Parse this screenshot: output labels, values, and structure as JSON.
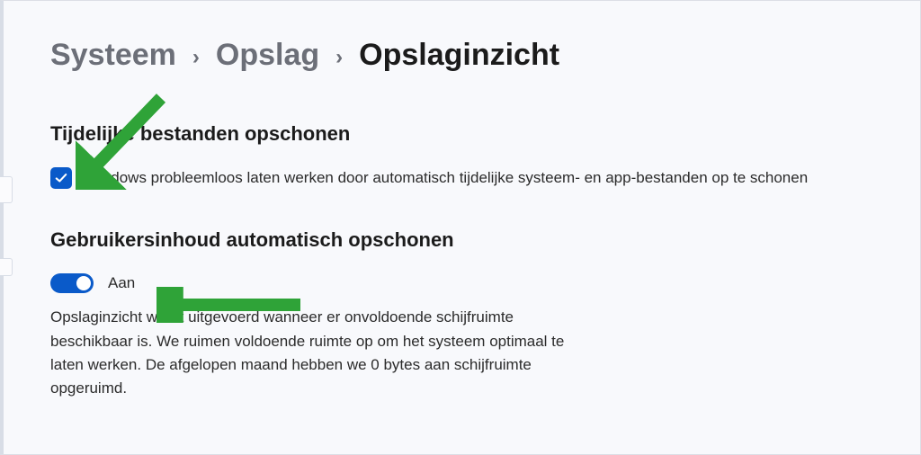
{
  "breadcrumb": {
    "system": "Systeem",
    "storage": "Opslag",
    "current": "Opslaginzicht"
  },
  "section1": {
    "heading": "Tijdelijke bestanden opschonen",
    "checkbox_label": "Windows probleemloos laten werken door automatisch tijdelijke systeem- en app-bestanden op te schonen",
    "checkbox_checked": true
  },
  "section2": {
    "heading": "Gebruikersinhoud automatisch opschonen",
    "toggle_state_label": "Aan",
    "toggle_on": true,
    "description": "Opslaginzicht wordt uitgevoerd wanneer er onvoldoende schijfruimte beschikbaar is. We ruimen voldoende ruimte op om het systeem optimaal te laten werken. De afgelopen maand hebben we 0 bytes aan schijfruimte opgeruimd."
  },
  "colors": {
    "accent": "#0a5ac9",
    "annotation": "#2fa338"
  }
}
